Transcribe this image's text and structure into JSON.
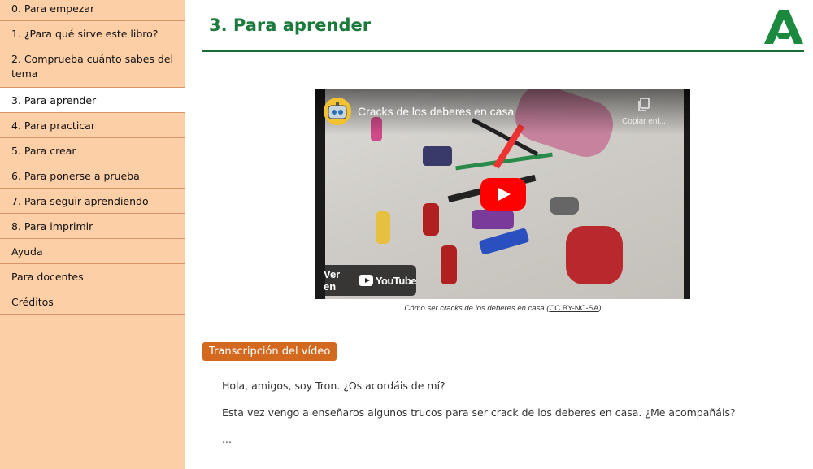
{
  "sidebar": {
    "items": [
      {
        "label": "0. Para empezar",
        "active": false
      },
      {
        "label": "1. ¿Para qué sirve este libro?",
        "active": false
      },
      {
        "label": "2. Comprueba cuánto sabes del tema",
        "active": false
      },
      {
        "label": "3. Para aprender",
        "active": true
      },
      {
        "label": "4. Para practicar",
        "active": false
      },
      {
        "label": "5. Para crear",
        "active": false
      },
      {
        "label": "6. Para ponerse a prueba",
        "active": false
      },
      {
        "label": "7. Para seguir aprendiendo",
        "active": false
      },
      {
        "label": "8. Para imprimir",
        "active": false
      },
      {
        "label": "Ayuda",
        "active": false
      },
      {
        "label": "Para docentes",
        "active": false
      },
      {
        "label": "Créditos",
        "active": false
      }
    ]
  },
  "main": {
    "title": "3. Para aprender",
    "video": {
      "title": "Cracks de los deberes en casa",
      "copy_label": "Copiar enl...",
      "watch_on": "Ver en",
      "youtube": "YouTube"
    },
    "caption": {
      "text": "Cómo ser cracks de los deberes en casa",
      "license": "CC BY-NC-SA"
    },
    "transcript_button": "Transcripción del vídeo",
    "transcript": [
      "Hola, amigos, soy Tron. ¿Os acordáis de mí?",
      "Esta vez vengo a enseñaros algunos trucos para ser crack de los deberes en casa. ¿Me acompañáis?",
      "..."
    ]
  },
  "colors": {
    "sidebar_bg": "#fdcfa6",
    "title_green": "#1b7a3c",
    "button_orange": "#d3691f",
    "youtube_red": "#ff0000"
  }
}
